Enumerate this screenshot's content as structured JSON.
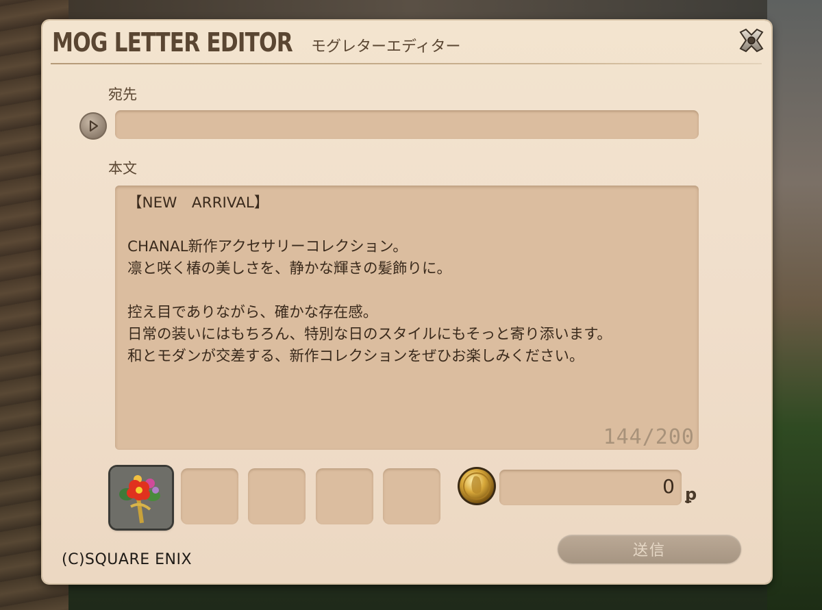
{
  "window": {
    "title_en": "MOG LETTER EDITOR",
    "title_jp": "モグレターエディター"
  },
  "recipient": {
    "label": "宛先",
    "value": ""
  },
  "body": {
    "label": "本文",
    "lines": [
      "【NEW　ARRIVAL】",
      "",
      "CHANAL新作アクセサリーコレクション。",
      "凛と咲く椿の美しさを、静かな輝きの髪飾りに。",
      "",
      "控え目でありながら、確かな存在感。",
      "日常の装いにはもちろん、特別な日のスタイルにもそっと寄り添います。",
      "和とモダンが交差する、新作コレクションをぜひお楽しみください。"
    ],
    "counter": "144/200"
  },
  "attachments": {
    "slots": [
      {
        "item_icon": "flower-hairpin-icon",
        "filled": true
      },
      {
        "filled": false
      },
      {
        "filled": false
      },
      {
        "filled": false
      },
      {
        "filled": false
      }
    ]
  },
  "gil": {
    "icon": "gil-coin-icon",
    "value": "0",
    "unit": "ꝑ"
  },
  "send_button": {
    "label": "送信",
    "enabled": false
  },
  "footer": {
    "copyright": "(C)SQUARE ENIX"
  },
  "colors": {
    "panel": "#f0decb",
    "field": "#dbbd9f",
    "text": "#3a2a1c",
    "title": "#5a4632"
  }
}
